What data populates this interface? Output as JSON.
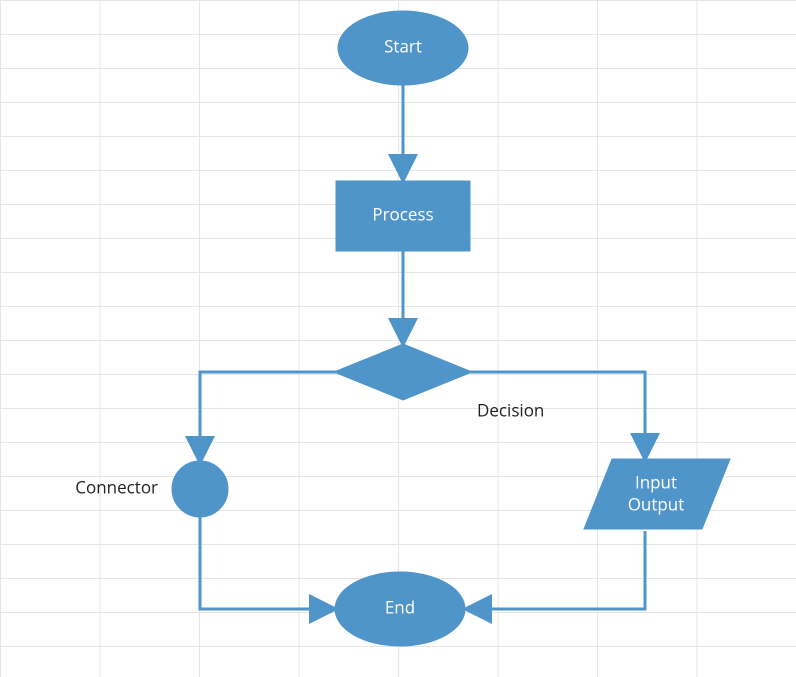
{
  "nodes": {
    "start": {
      "label": "Start"
    },
    "process": {
      "label": "Process"
    },
    "decision": {
      "label": "Decision"
    },
    "connector": {
      "label": "Connector"
    },
    "io_line1": {
      "label": "Input"
    },
    "io_line2": {
      "label": "Output"
    },
    "end": {
      "label": "End"
    }
  },
  "colors": {
    "shape": "#4f95ca"
  }
}
